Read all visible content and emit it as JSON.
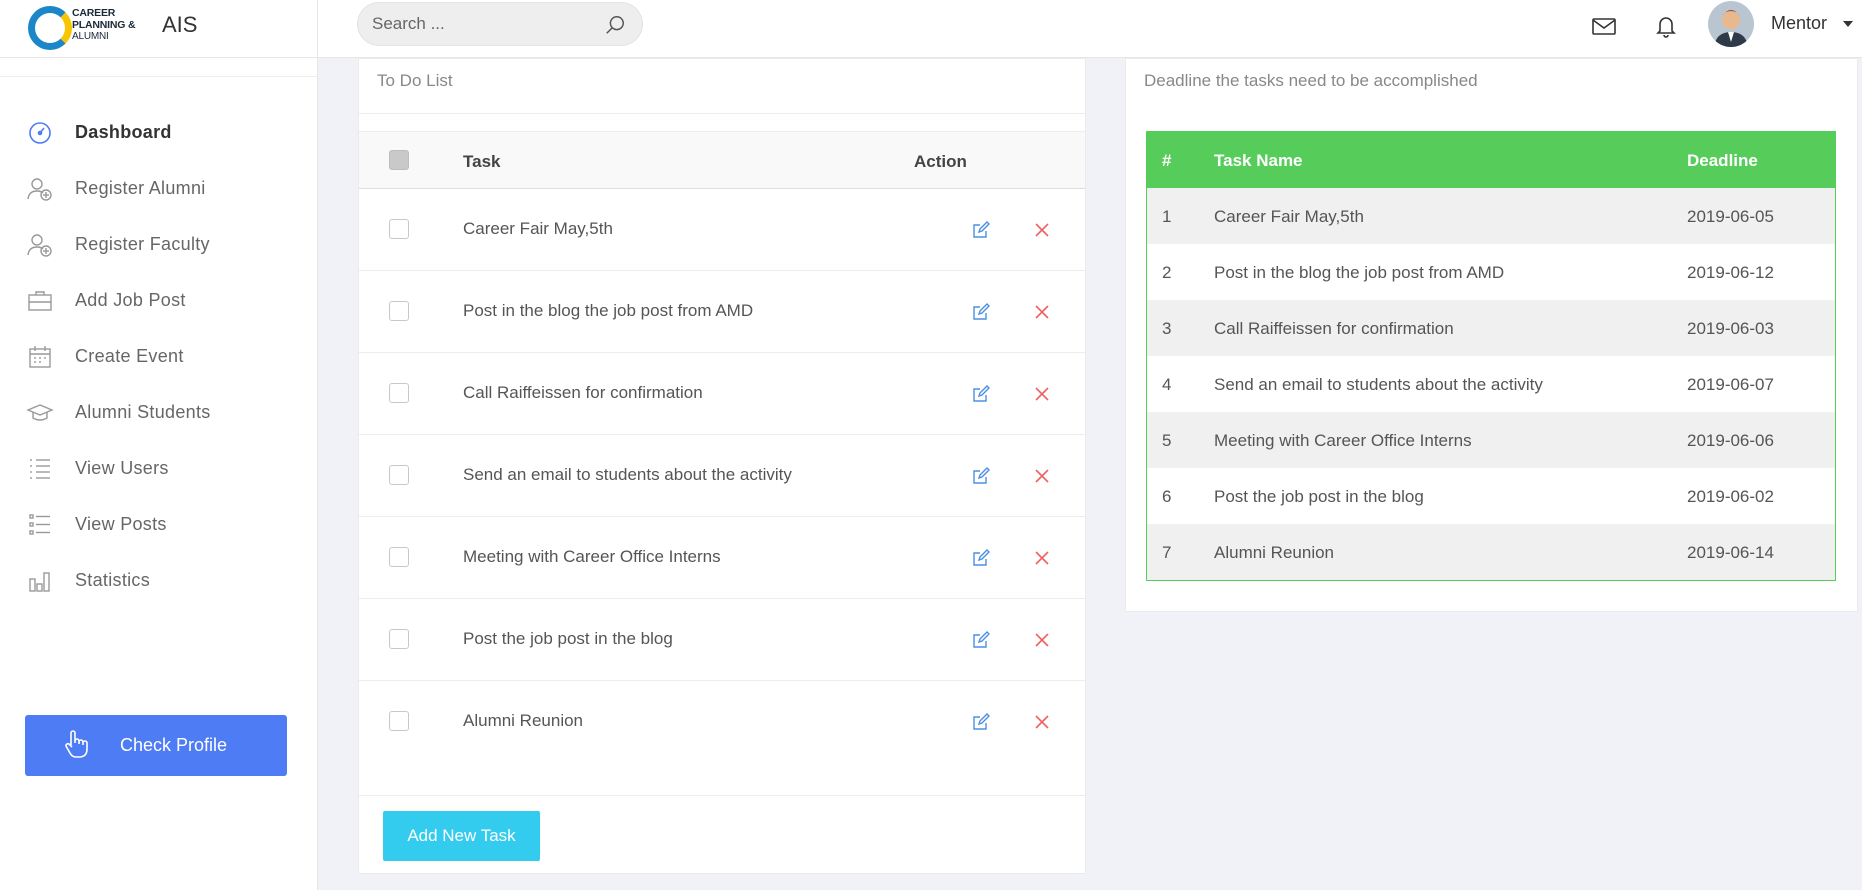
{
  "brand": {
    "logo_line1": "CAREER",
    "logo_line2": "PLANNING &",
    "logo_line3": "ALUMNI",
    "app_name": "AIS"
  },
  "search": {
    "placeholder": "Search ..."
  },
  "header": {
    "user_name": "Mentor"
  },
  "sidebar": {
    "items": [
      {
        "label": "Dashboard",
        "icon": "dashboard-gauge-icon"
      },
      {
        "label": "Register Alumni",
        "icon": "user-add-icon"
      },
      {
        "label": "Register Faculty",
        "icon": "user-add-icon"
      },
      {
        "label": "Add Job Post",
        "icon": "briefcase-icon"
      },
      {
        "label": "Create Event",
        "icon": "calendar-icon"
      },
      {
        "label": "Alumni Students",
        "icon": "graduation-cap-icon"
      },
      {
        "label": "View Users",
        "icon": "list-icon"
      },
      {
        "label": "View Posts",
        "icon": "list-icon"
      },
      {
        "label": "Statistics",
        "icon": "bar-chart-icon"
      }
    ],
    "check_profile_label": "Check Profile"
  },
  "todo": {
    "title": "To Do List",
    "col_task": "Task",
    "col_action": "Action",
    "tasks": [
      "Career Fair May,5th",
      "Post in the blog the job post from AMD",
      "Call Raiffeissen for confirmation",
      "Send an email to students about the activity",
      "Meeting with Career Office Interns",
      "Post the job post in the blog",
      "Alumni Reunion"
    ],
    "add_label": "Add New Task"
  },
  "deadlines": {
    "title": "Deadline the tasks need to be accomplished",
    "col_num": "#",
    "col_name": "Task Name",
    "col_deadline": "Deadline",
    "rows": [
      {
        "num": "1",
        "name": "Career Fair May,5th",
        "deadline": "2019-06-05"
      },
      {
        "num": "2",
        "name": "Post in the blog the job post from AMD",
        "deadline": "2019-06-12"
      },
      {
        "num": "3",
        "name": "Call Raiffeissen for confirmation",
        "deadline": "2019-06-03"
      },
      {
        "num": "4",
        "name": "Send an email to students about the activity",
        "deadline": "2019-06-07"
      },
      {
        "num": "5",
        "name": "Meeting with Career Office Interns",
        "deadline": "2019-06-06"
      },
      {
        "num": "6",
        "name": "Post the job post in the blog",
        "deadline": "2019-06-02"
      },
      {
        "num": "7",
        "name": "Alumni Reunion",
        "deadline": "2019-06-14"
      }
    ]
  },
  "colors": {
    "accent_blue": "#4e7cf5",
    "table_green": "#56cd5a",
    "add_button": "#33ccee",
    "delete_red": "#f06060",
    "edit_blue": "#4a90e2"
  }
}
